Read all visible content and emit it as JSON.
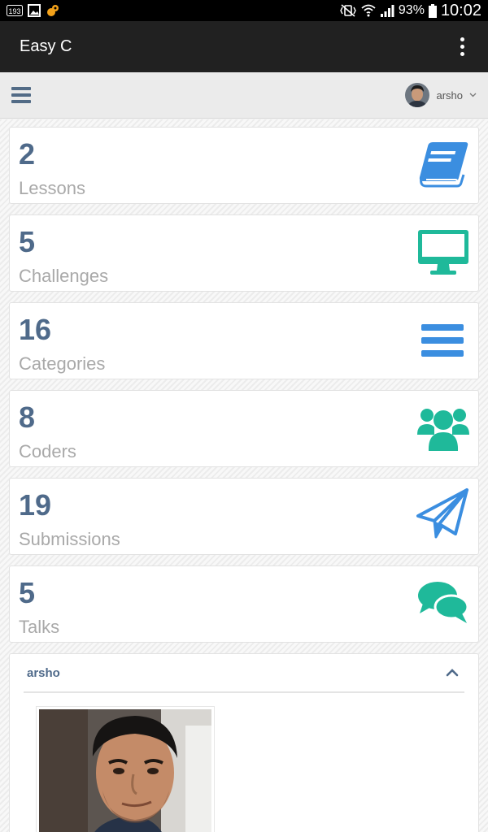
{
  "status_bar": {
    "notification_badge": "193",
    "battery": "93%",
    "time": "10:02"
  },
  "app_bar": {
    "title": "Easy C"
  },
  "header": {
    "username": "arsho"
  },
  "stats": [
    {
      "value": "2",
      "label": "Lessons",
      "icon": "book-icon",
      "color": "#3b8ee0"
    },
    {
      "value": "5",
      "label": "Challenges",
      "icon": "desktop-icon",
      "color": "#1fb99a"
    },
    {
      "value": "16",
      "label": "Categories",
      "icon": "list-icon",
      "color": "#3b8ee0"
    },
    {
      "value": "8",
      "label": "Coders",
      "icon": "users-icon",
      "color": "#1fb99a"
    },
    {
      "value": "19",
      "label": "Submissions",
      "icon": "paper-plane-icon",
      "color": "#3b8ee0"
    },
    {
      "value": "5",
      "label": "Talks",
      "icon": "comments-icon",
      "color": "#1fb99a"
    }
  ],
  "profile": {
    "name": "arsho"
  },
  "colors": {
    "accent_blue": "#3b8ee0",
    "accent_green": "#1fb99a",
    "number_text": "#4f6a8a",
    "label_text": "#a9a9a9",
    "app_bar": "#212121"
  }
}
